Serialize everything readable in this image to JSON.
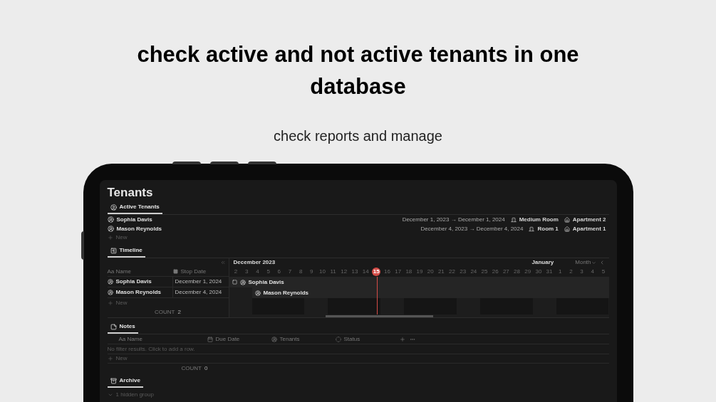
{
  "headline": "check active and not active tenants in one database",
  "subheadline": "check reports and manage",
  "page": {
    "title": "Tenants"
  },
  "active_tenants": {
    "tab": {
      "label": "Active Tenants",
      "selected": true
    },
    "rows": [
      {
        "name": "Sophia Davis",
        "dates": "December 1, 2023 → December 1, 2024",
        "room": "Medium Room",
        "apartment": "Apartment 2"
      },
      {
        "name": "Mason Reynolds",
        "dates": "December 4, 2023 → December 4, 2024",
        "room": "Room 1",
        "apartment": "Apartment 1"
      }
    ],
    "new_label": "New"
  },
  "timeline": {
    "tab": {
      "label": "Timeline",
      "selected": true
    },
    "columns": [
      {
        "icon_text": "Aa",
        "label": "Name"
      },
      {
        "label": "Stop Date"
      }
    ],
    "rows": [
      {
        "name": "Sophia Davis",
        "stop_date": "December 1, 2024",
        "bar_label": "Sophia Davis"
      },
      {
        "name": "Mason Reynolds",
        "stop_date": "December 4, 2024",
        "bar_label": "Mason Reynolds"
      }
    ],
    "new_label": "New",
    "count_label": "COUNT",
    "count": "2",
    "month": "December 2023",
    "next_month": "January",
    "view": "Month",
    "days": [
      {
        "label": "2",
        "selected": false
      },
      {
        "label": "3",
        "selected": false
      },
      {
        "label": "4",
        "selected": false
      },
      {
        "label": "5",
        "selected": false
      },
      {
        "label": "6",
        "selected": false
      },
      {
        "label": "7",
        "selected": false
      },
      {
        "label": "8",
        "selected": false
      },
      {
        "label": "9",
        "selected": false
      },
      {
        "label": "10",
        "selected": false
      },
      {
        "label": "11",
        "selected": false
      },
      {
        "label": "12",
        "selected": false
      },
      {
        "label": "13",
        "selected": false
      },
      {
        "label": "14",
        "selected": false
      },
      {
        "label": "15",
        "selected": true
      },
      {
        "label": "16",
        "selected": false
      },
      {
        "label": "17",
        "selected": false
      },
      {
        "label": "18",
        "selected": false
      },
      {
        "label": "19",
        "selected": false
      },
      {
        "label": "20",
        "selected": false
      },
      {
        "label": "21",
        "selected": false
      },
      {
        "label": "22",
        "selected": false
      },
      {
        "label": "23",
        "selected": false
      },
      {
        "label": "24",
        "selected": false
      },
      {
        "label": "25",
        "selected": false
      },
      {
        "label": "26",
        "selected": false
      },
      {
        "label": "27",
        "selected": false
      },
      {
        "label": "28",
        "selected": false
      },
      {
        "label": "29",
        "selected": false
      },
      {
        "label": "30",
        "selected": false
      },
      {
        "label": "31",
        "selected": false
      },
      {
        "label": "1",
        "selected": false
      },
      {
        "label": "2",
        "selected": false
      },
      {
        "label": "3",
        "selected": false
      },
      {
        "label": "4",
        "selected": false
      },
      {
        "label": "5",
        "selected": false
      }
    ]
  },
  "notes": {
    "tab": {
      "label": "Notes",
      "selected": true
    },
    "columns": [
      {
        "kind": "title",
        "icon_text": "Aa",
        "label": "Name"
      },
      {
        "kind": "date",
        "label": "Due Date"
      },
      {
        "kind": "person",
        "label": "Tenants"
      },
      {
        "kind": "status",
        "label": "Status"
      }
    ],
    "empty_text": "No filter results. Click to add a row.",
    "new_label": "New",
    "count_label": "COUNT",
    "count": "0"
  },
  "archive": {
    "tab": {
      "label": "Archive",
      "selected": true
    },
    "hidden_groups": "1 hidden group"
  }
}
